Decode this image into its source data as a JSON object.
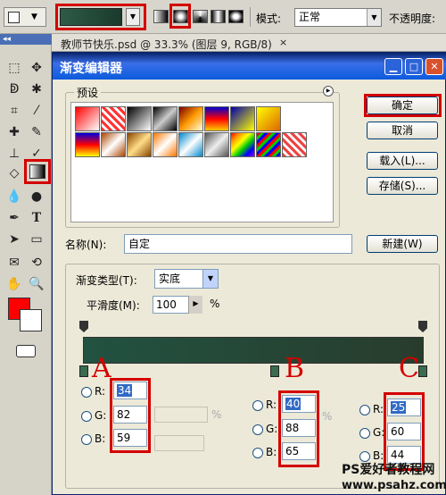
{
  "optbar": {
    "mode_label": "模式:",
    "mode_value": "正常",
    "opacity_label": "不透明度:"
  },
  "doc": {
    "tab_title": "教师节快乐.psd @ 33.3% (图层 9, RGB/8)",
    "close": "×"
  },
  "dialog": {
    "title": "渐变编辑器",
    "presets_label": "预设",
    "buttons": {
      "ok": "确定",
      "cancel": "取消",
      "load": "载入(L)...",
      "save": "存储(S)...",
      "new": "新建(W)"
    },
    "name_label": "名称(N):",
    "name_value": "自定",
    "gradient_type_label": "渐变类型(T):",
    "gradient_type_value": "实底",
    "smoothness_label": "平滑度(M):",
    "smoothness_value": "100",
    "smoothness_unit": "%"
  },
  "stops": {
    "A": {
      "letter": "A",
      "r": "34",
      "g": "82",
      "b": "59"
    },
    "B": {
      "letter": "B",
      "r": "40",
      "g": "88",
      "b": "65"
    },
    "C": {
      "letter": "C",
      "r": "25",
      "g": "60",
      "b": "44"
    },
    "r_label": "R:",
    "g_label": "G:",
    "b_label": "B:",
    "pct": "%"
  },
  "colors": {
    "foreground": "#ff0000",
    "background": "#ffffff",
    "gradient_start": "#225241",
    "gradient_end": "#283c2c",
    "highlight": "#d40000"
  },
  "watermark": {
    "line1": "PS爱好者教程网",
    "line2": "www.psahz.com"
  }
}
